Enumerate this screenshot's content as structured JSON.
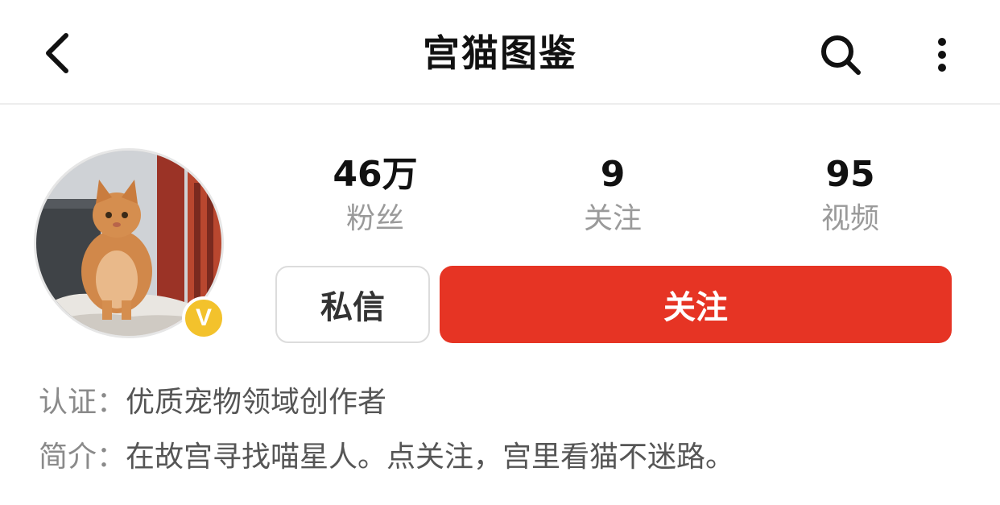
{
  "header": {
    "title": "宫猫图鉴",
    "back_icon": "chevron-left-icon",
    "search_icon": "search-icon",
    "more_icon": "more-vertical-icon"
  },
  "profile": {
    "avatar_alt": "orange cat avatar",
    "verified_badge": "V",
    "verified_color": "#f3c22c"
  },
  "stats": [
    {
      "value": "46万",
      "label": "粉丝"
    },
    {
      "value": "9",
      "label": "关注"
    },
    {
      "value": "95",
      "label": "视频"
    }
  ],
  "actions": {
    "message_label": "私信",
    "follow_label": "关注",
    "follow_color": "#e63424"
  },
  "info": {
    "certification_label": "认证：",
    "certification_value": "优质宠物领域创作者",
    "intro_label": "简介：",
    "intro_value": "在故宫寻找喵星人。点关注，宫里看猫不迷路。"
  }
}
